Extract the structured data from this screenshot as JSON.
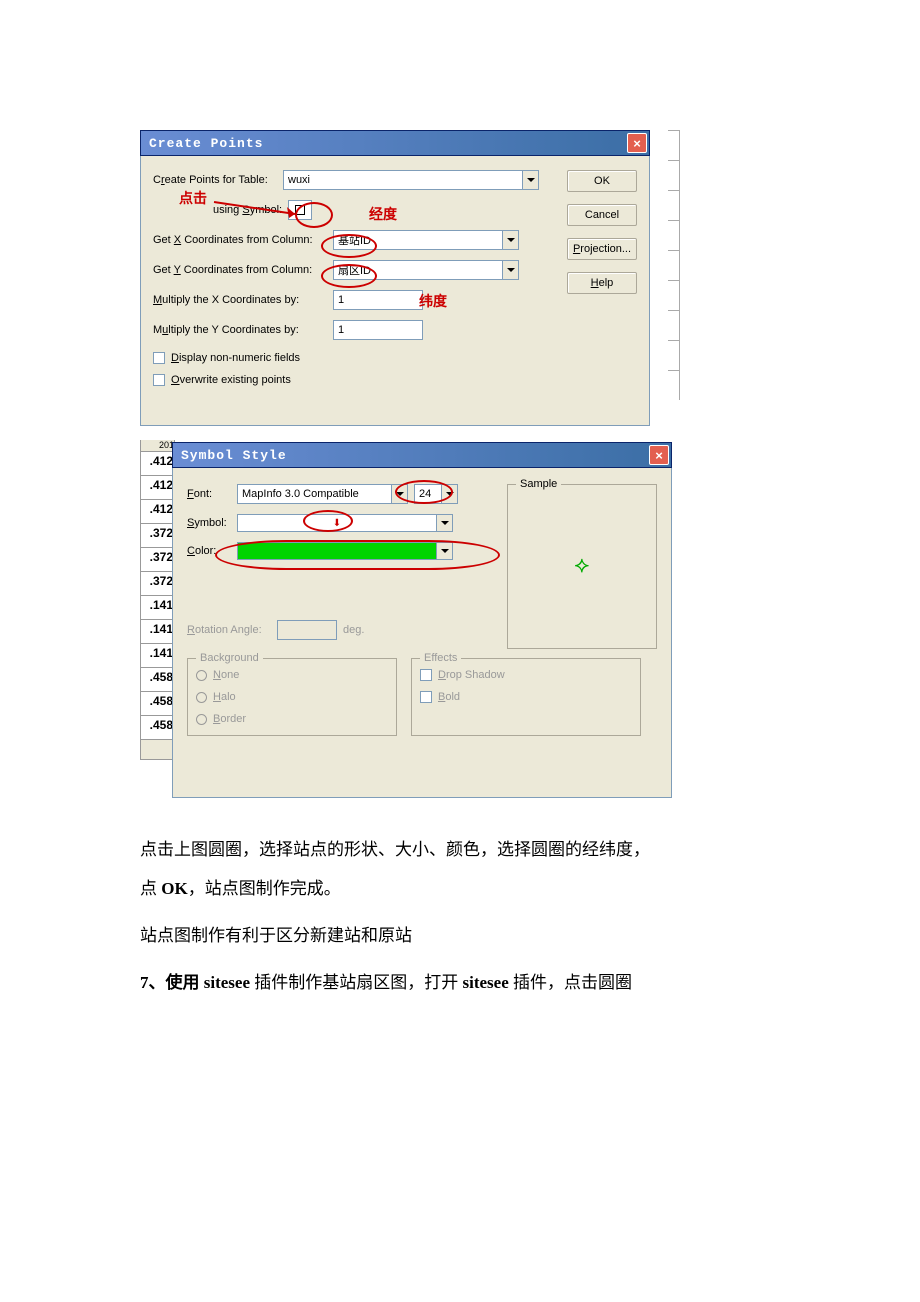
{
  "createPoints": {
    "title": "Create Points",
    "tableLabelPre": "C",
    "tableLabelU": "r",
    "tableLabelPost": "eate Points for Table:",
    "tableValue": "wuxi",
    "symbolLabelPre": "using ",
    "symbolLabelU": "S",
    "symbolLabelPost": "ymbol:",
    "getXLabelPre": "Get ",
    "getXLabelU": "X",
    "getXLabelPost": " Coordinates from Column:",
    "getXValue": "基站ID",
    "getYLabelPre": "Get ",
    "getYLabelU": "Y",
    "getYLabelPost": " Coordinates from Column:",
    "getYValue": "扇区ID",
    "multXLabelPre": "",
    "multXLabelU": "M",
    "multXLabelPost": "ultiply the X Coordinates by:",
    "multXValue": "1",
    "multYLabelPre": "M",
    "multYLabelU": "u",
    "multYLabelPost": "ltiply the Y Coordinates by:",
    "multYValue": "1",
    "chkDisplayU": "D",
    "chkDisplay": "isplay non-numeric fields",
    "chkOverwriteU": "O",
    "chkOverwrite": "verwrite existing points",
    "buttons": {
      "ok": "OK",
      "cancel": "Cancel",
      "projU": "P",
      "proj": "rojection...",
      "helpU": "H",
      "help": "elp"
    },
    "annotations": {
      "click": "点击",
      "jingdu": "经度",
      "weidu": "纬度"
    }
  },
  "symbolStyle": {
    "title": "Symbol Style",
    "fontLabelU": "F",
    "fontLabel": "ont:",
    "fontValue": "MapInfo 3.0 Compatible",
    "sizeValue": "24",
    "symbolLabelU": "S",
    "symbolLabel": "ymbol:",
    "colorLabelU": "C",
    "colorLabel": "olor:",
    "rotationLabelU": "R",
    "rotationLabel": "otation Angle:",
    "deg": "deg.",
    "sample": "Sample",
    "background": {
      "legend": "Background",
      "noneU": "N",
      "none": "one",
      "haloU": "H",
      "halo": "alo",
      "borderU": "B",
      "border": "order"
    },
    "effects": {
      "legend": "Effects",
      "dropU": "D",
      "drop": "rop Shadow",
      "boldU": "B",
      "bold": "old"
    }
  },
  "dataColumn": [
    "201",
    ".412",
    ".412",
    ".412",
    ".372",
    ".372",
    ".372",
    ".141",
    ".141",
    ".141",
    ".458",
    ".458",
    ".458"
  ],
  "paragraph": {
    "p1a": "点击上图圆圈，选择站点的形状、大小、颜色，选择圆圈的经纬度，",
    "p1b": "点 ",
    "p1bold": "OK",
    "p1c": "，站点图制作完成。",
    "p2": "站点图制作有利于区分新建站和原站",
    "p3a": "7、使用 ",
    "p3b1": "sitesee ",
    "p3b": "插件制作基站扇区图，打开 ",
    "p3b2": "sitesee ",
    "p3c": "插件，点击圆圈"
  }
}
